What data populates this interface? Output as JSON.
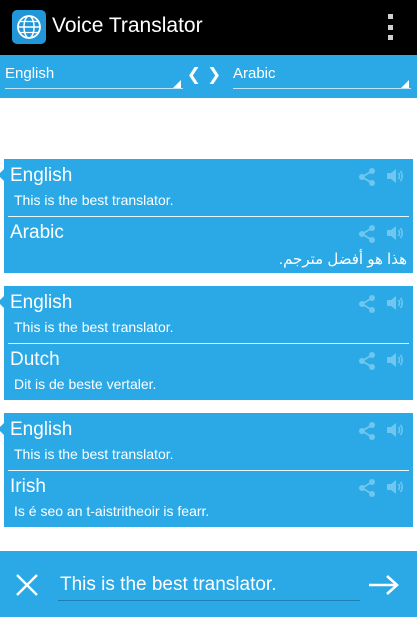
{
  "app": {
    "title": "Voice Translator"
  },
  "language_bar": {
    "source": "English",
    "target": "Arabic",
    "swap_label": "❮❯"
  },
  "cards": [
    {
      "source": {
        "language": "English",
        "text": "This is the best translator."
      },
      "target": {
        "language": "Arabic",
        "text": "هذا هو أفضل مترجم."
      }
    },
    {
      "source": {
        "language": "English",
        "text": "This is the best translator."
      },
      "target": {
        "language": "Dutch",
        "text": "Dit is de beste vertaler."
      }
    },
    {
      "source": {
        "language": "English",
        "text": "This is the best translator."
      },
      "target": {
        "language": "Irish",
        "text": "Is é seo an t-aistritheoir is fearr."
      }
    }
  ],
  "input": {
    "value": "This is the best translator."
  },
  "colors": {
    "action_bar": "#000000",
    "accent": "#2aa9e6",
    "icon_muted": "#6fc6ee"
  },
  "icons": {
    "app": "globe-icon",
    "menu": "overflow-menu-icon",
    "share": "share-icon",
    "speaker": "speaker-icon",
    "clear": "close-icon",
    "send": "arrow-right-icon"
  }
}
